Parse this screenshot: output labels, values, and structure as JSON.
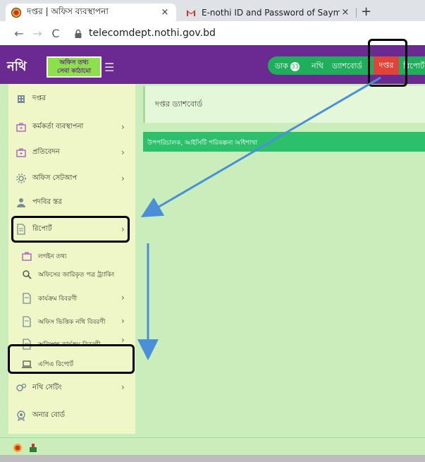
{
  "browser": {
    "tabs": [
      {
        "title": "দপ্তর | অফিস ব্যবস্থাপনা",
        "active": true,
        "favicon": "nothi-favicon",
        "close": "×"
      },
      {
        "title": "E-nothi ID and Password of Saym",
        "active": false,
        "favicon": "gmail-icon",
        "close": "×"
      }
    ],
    "new_tab": "+",
    "url": "telecomdept.nothi.gov.bd"
  },
  "header": {
    "logo_text": "নথি",
    "logo_line1": "অফিস তথ্য",
    "logo_line2": "সেবা কাঠামো",
    "nav": {
      "dak": "ডাক",
      "dak_count": "33",
      "nothi": "নথি",
      "dashboard": "ড্যাশবোর্ড",
      "daptar": "দপ্তর",
      "report": "রিপোর্ট"
    }
  },
  "sidebar": {
    "items": [
      {
        "label": "দপ্তর",
        "icon": "building-icon"
      },
      {
        "label": "কর্মকর্তা ব্যবস্থাপনা",
        "icon": "briefcase-icon"
      },
      {
        "label": "প্রতিবেদন",
        "icon": "briefcase-icon"
      },
      {
        "label": "অফিস সেটআপ",
        "icon": "gear-icon"
      },
      {
        "label": "পদবির স্তর",
        "icon": "user-icon"
      },
      {
        "label": "রিপোর্ট",
        "icon": "document-icon"
      }
    ],
    "sub_items": [
      {
        "label": "লগইন তথ্য",
        "icon": "briefcase-icon"
      },
      {
        "label": "অফিসের জারিকৃত পত্র ট্র্যাকিং",
        "icon": "search-icon"
      },
      {
        "label": "কার্যক্রম বিবরণী",
        "icon": "document-icon"
      },
      {
        "label": "অফিস ভিত্তিক নথি বিবরণী",
        "icon": "document-icon"
      },
      {
        "label": "অনিষ্পন্ন কার্যক্রম বিবরণী",
        "icon": "document-icon"
      },
      {
        "label": "এপিএ রিপোর্ট",
        "icon": "laptop-icon"
      }
    ],
    "bottom_items": [
      {
        "label": "নথি সেটিং",
        "icon": "settings-icon"
      },
      {
        "label": "অনার বোর্ড",
        "icon": "award-icon"
      }
    ],
    "chevron": "›"
  },
  "main": {
    "breadcrumb": "দপ্তর ড্যাশবোর্ড",
    "designation": "উপপরিচালক, আইসিটি পরিকল্পনা অধিশাখা"
  },
  "colors": {
    "header": "#6b2a8f",
    "nav_green": "#1fae5b",
    "daptar_red": "#e0433a",
    "sidebar_bg": "#eef7c5",
    "content_bg": "#c9eebb",
    "annotation_arrow": "#4a90d9"
  }
}
